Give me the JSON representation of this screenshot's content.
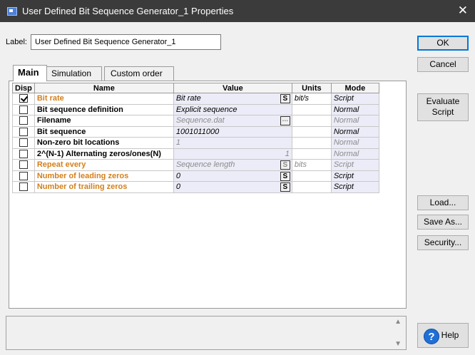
{
  "window": {
    "title": "User Defined Bit Sequence Generator_1 Properties",
    "close_glyph": "✕"
  },
  "label": {
    "caption": "Label:",
    "value": "User Defined Bit Sequence Generator_1"
  },
  "buttons": {
    "ok": "OK",
    "cancel": "Cancel",
    "evaluate_script_line1": "Evaluate",
    "evaluate_script_line2": "Script",
    "load": "Load...",
    "save_as": "Save As...",
    "security": "Security...",
    "help": "Help"
  },
  "tabs": [
    {
      "label": "Main",
      "active": true
    },
    {
      "label": "Simulation",
      "active": false
    },
    {
      "label": "Custom order",
      "active": false
    }
  ],
  "table": {
    "headers": {
      "disp": "Disp",
      "name": "Name",
      "value": "Value",
      "units": "Units",
      "mode": "Mode"
    },
    "rows": [
      {
        "disp": true,
        "name": "Bit rate",
        "name_style": "script",
        "value": "Bit rate",
        "value_style": "normal",
        "s_button": "S",
        "units": "bit/s",
        "mode": "Script"
      },
      {
        "disp": false,
        "name": "Bit sequence definition",
        "name_style": "normal",
        "value": "Explicit sequence",
        "value_style": "normal",
        "units": "",
        "mode": "Normal"
      },
      {
        "disp": false,
        "name": "Filename",
        "name_style": "normal",
        "value": "Sequence.dat",
        "value_style": "disabled",
        "browse_button": "...",
        "units": "",
        "mode": "Normal"
      },
      {
        "disp": false,
        "name": "Bit sequence",
        "name_style": "normal",
        "value": "1001011000",
        "value_style": "normal",
        "units": "",
        "mode": "Normal"
      },
      {
        "disp": false,
        "name": "Non-zero bit locations",
        "name_style": "normal",
        "value": "1",
        "value_style": "disabled",
        "units": "",
        "mode": "Normal"
      },
      {
        "disp": false,
        "name": "2^(N-1) Alternating zeros/ones(N)",
        "name_style": "normal",
        "value": "1",
        "value_style": "disabled-right",
        "units": "",
        "mode": "Normal"
      },
      {
        "disp": false,
        "name": "Repeat every",
        "name_style": "script",
        "value": "Sequence length",
        "value_style": "disabled",
        "s_button": "S",
        "units": "bits",
        "mode": "Script"
      },
      {
        "disp": false,
        "name": "Number of leading zeros",
        "name_style": "script",
        "value": "0",
        "value_style": "normal",
        "s_button": "S",
        "units": "",
        "mode": "Script"
      },
      {
        "disp": false,
        "name": "Number of trailing zeros",
        "name_style": "script",
        "value": "0",
        "value_style": "normal",
        "s_button": "S",
        "units": "",
        "mode": "Script"
      }
    ]
  },
  "icons": {
    "app": "app-window-icon",
    "help": "question-mark-icon",
    "scroll_up": "▲",
    "scroll_down": "▼"
  },
  "colors": {
    "titlebar": "#3b3b3b",
    "script_name": "#d47f1a",
    "value_cell_bg": "#ececf8",
    "default_button_border": "#0078d7",
    "help_icon": "#1f6fd6"
  }
}
